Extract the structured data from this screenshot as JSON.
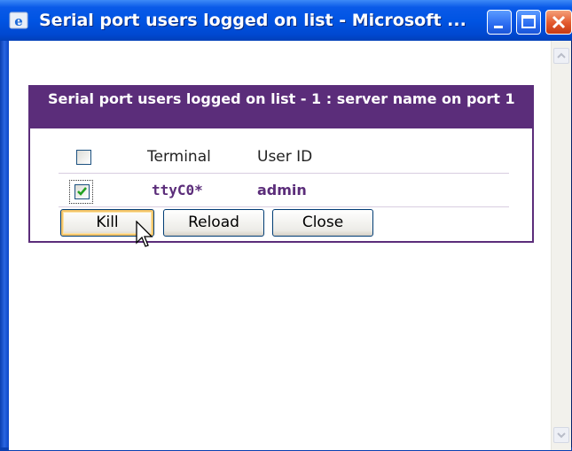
{
  "window": {
    "title": "Serial port users logged on list - Microsoft ..."
  },
  "panel": {
    "title": "Serial port users logged on list - 1 : server name on port 1"
  },
  "table": {
    "columns": [
      "Terminal",
      "User ID"
    ],
    "rows": [
      {
        "terminal": "ttyC0*",
        "user_id": "admin",
        "checked": true
      }
    ],
    "select_all_checked": false
  },
  "buttons": {
    "kill": "Kill",
    "reload": "Reload",
    "close": "Close"
  },
  "colors": {
    "panel_accent": "#5b2d7a",
    "titlebar": "#0054e3"
  }
}
